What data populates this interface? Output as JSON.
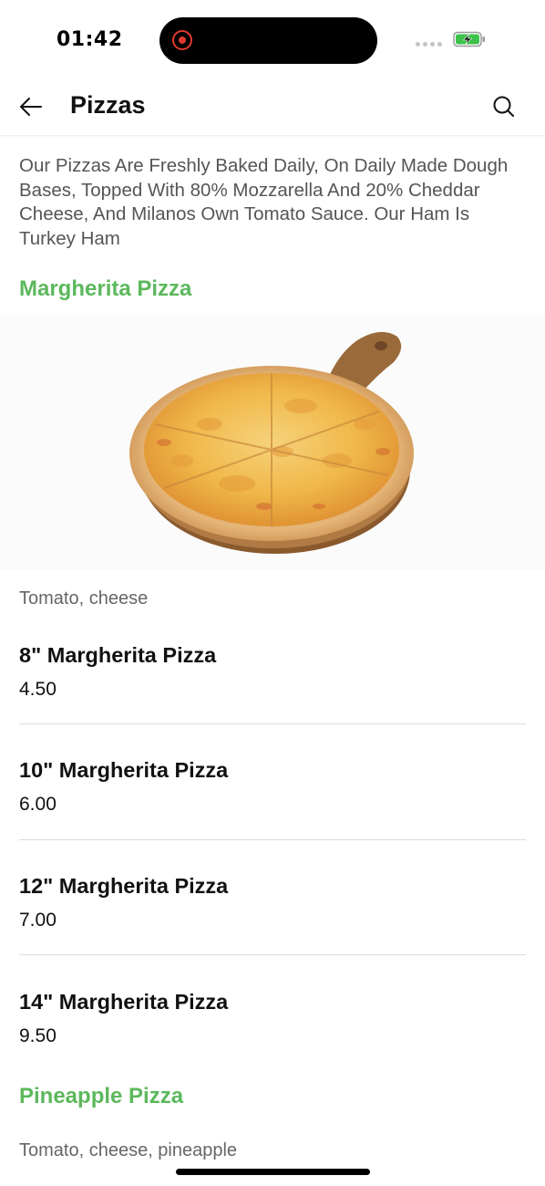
{
  "status_bar": {
    "time": "01:42"
  },
  "header": {
    "title": "Pizzas",
    "back_icon": "arrow-left-icon",
    "search_icon": "search-icon"
  },
  "intro": "Our Pizzas Are Freshly Baked Daily, On Daily Made Dough Bases, Topped With 80% Mozzarella And 20% Cheddar Cheese, And Milanos Own Tomato Sauce. Our Ham Is Turkey Ham",
  "colors": {
    "accent": "#5cb85c",
    "text": "#111111",
    "muted": "#666666"
  },
  "sections": [
    {
      "title": "Margherita Pizza",
      "description": "Tomato, cheese",
      "items": [
        {
          "name": "8\" Margherita Pizza",
          "price": "4.50"
        },
        {
          "name": "10\" Margherita Pizza",
          "price": "6.00"
        },
        {
          "name": "12\" Margherita Pizza",
          "price": "7.00"
        },
        {
          "name": "14\" Margherita Pizza",
          "price": "9.50"
        }
      ]
    },
    {
      "title": "Pineapple Pizza",
      "description": "Tomato, cheese, pineapple"
    }
  ]
}
